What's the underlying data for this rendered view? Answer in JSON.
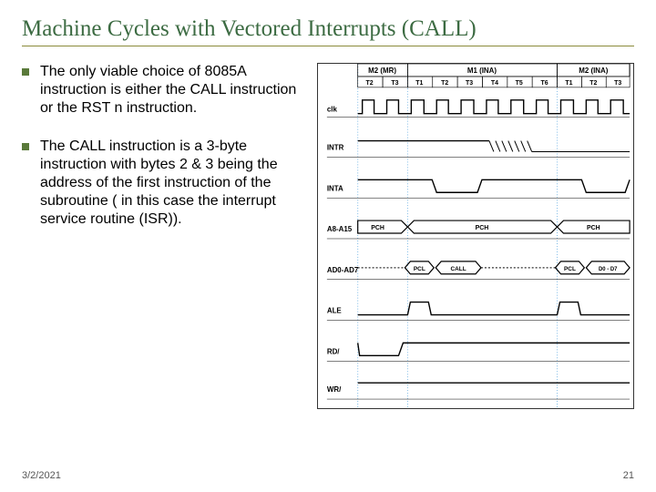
{
  "title": "Machine Cycles with Vectored Interrupts (CALL)",
  "bullets": [
    "The only viable choice of 8085A instruction is either the  CALL  instruction or the  RST n  instruction.",
    "The CALL instruction is a 3-byte instruction with bytes 2 & 3 being the address of the first instruction of the subroutine ( in this case the interrupt service routine (ISR))."
  ],
  "diagram": {
    "header_cycles": [
      "M2 (MR)",
      "M1 (INA)",
      "M2 (INA)"
    ],
    "header_tstates": [
      "T2",
      "T3",
      "T1",
      "T2",
      "T3",
      "T4",
      "T5",
      "T6",
      "T1",
      "T2",
      "T3"
    ],
    "signals": [
      "clk",
      "INTR",
      "INTA",
      "A8-A15",
      "AD0-AD7",
      "ALE",
      "RD/",
      "WR/"
    ],
    "bus_labels": [
      "PCH",
      "PCH",
      "PCH",
      "PCL",
      "CALL",
      "PCL",
      "D0 - D7"
    ]
  },
  "footer": {
    "date": "3/2/2021",
    "page": "21"
  }
}
